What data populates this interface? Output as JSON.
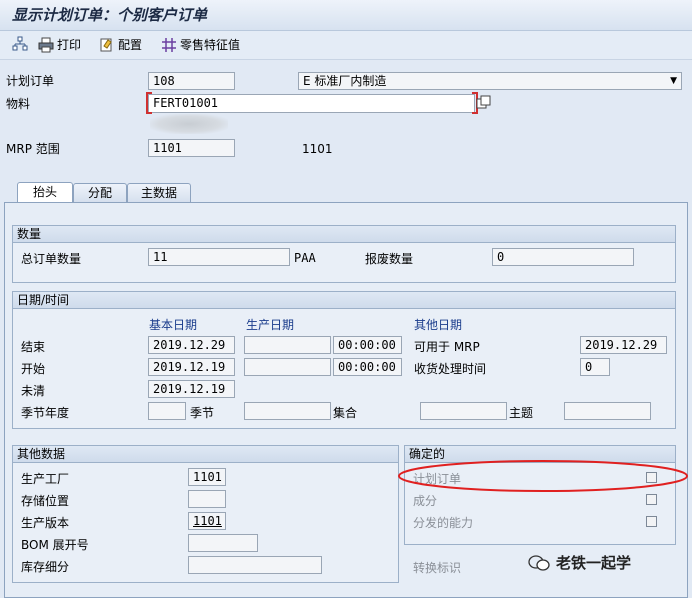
{
  "window_title": "显示计划订单：个别客户订单",
  "toolbar": {
    "print_label": "打印",
    "config_label": "配置",
    "zero_sale_label": "零售特征值"
  },
  "header": {
    "plan_order_label": "计划订单",
    "plan_order_value": "108",
    "order_type_value": "E 标准厂内制造",
    "material_label": "物料",
    "material_value": "FERT01001",
    "mrp_area_label": "MRP 范围",
    "mrp_area_value": "1101",
    "mrp_area_text": "1101"
  },
  "tabs": [
    {
      "label": "抬头",
      "active": true
    },
    {
      "label": "分配",
      "active": false
    },
    {
      "label": "主数据",
      "active": false
    }
  ],
  "quantity": {
    "title": "数量",
    "total_label": "总订单数量",
    "total_value": "11",
    "unit": "PAA",
    "scrap_label": "报废数量",
    "scrap_value": "0"
  },
  "dates": {
    "title": "日期/时间",
    "basic_dates_header": "基本日期",
    "production_dates_header": "生产日期",
    "other_dates_header": "其他日期",
    "end_label": "结束",
    "end_value": "2019.12.29",
    "end_time": "00:00:00",
    "mrp_avail_label": "可用于 MRP",
    "mrp_avail_value": "2019.12.29",
    "start_label": "开始",
    "start_value": "2019.12.19",
    "start_time": "00:00:00",
    "gr_time_label": "收货处理时间",
    "gr_time_value": "0",
    "open_label": "未清",
    "open_value": "2019.12.19",
    "season_year_label": "季节年度",
    "season_label": "季节",
    "collection_label": "集合",
    "theme_label": "主题"
  },
  "other_data": {
    "title": "其他数据",
    "plant_label": "生产工厂",
    "plant_value": "1101",
    "storage_label": "存储位置",
    "version_label": "生产版本",
    "version_value": "1101",
    "bom_label": "BOM 展开号",
    "stock_label": "库存细分"
  },
  "firmed": {
    "title": "确定的",
    "plan_order_label": "计划订单",
    "components_label": "成分",
    "capacity_label": "分发的能力",
    "conversion_label": "转换标识"
  },
  "watermark": "老铁一起学",
  "colors": {
    "highlight_ellipse": "#e02020",
    "required_marker": "#d03030"
  }
}
